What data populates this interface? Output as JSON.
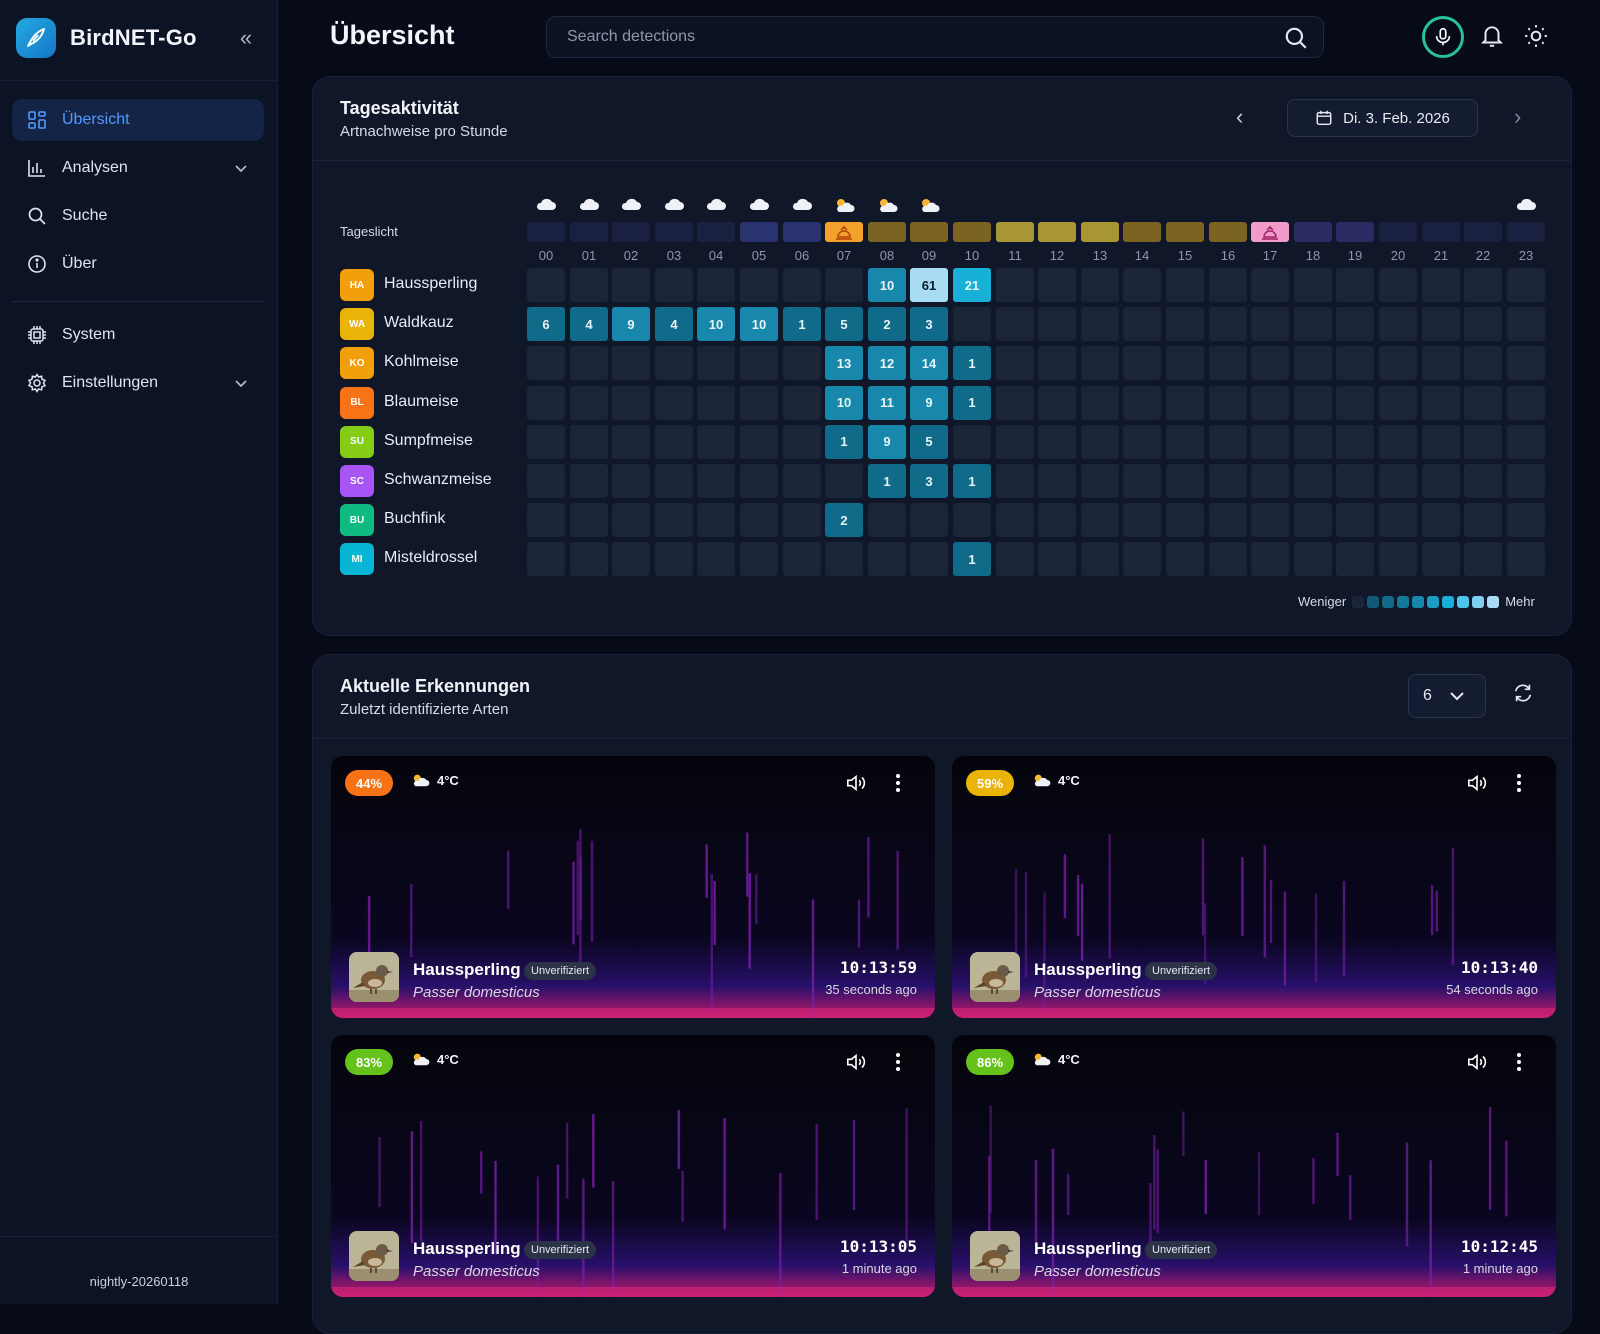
{
  "app": {
    "name": "BirdNET-Go",
    "version": "nightly-20260118"
  },
  "sidebar": {
    "items": [
      {
        "label": "Übersicht",
        "icon": "dashboard-grid-icon",
        "active": true
      },
      {
        "label": "Analysen",
        "icon": "bar-chart-icon",
        "expandable": true
      },
      {
        "label": "Suche",
        "icon": "search-icon"
      },
      {
        "label": "Über",
        "icon": "info-icon"
      },
      {
        "label": "System",
        "icon": "cpu-chip-icon"
      },
      {
        "label": "Einstellungen",
        "icon": "gear-icon",
        "expandable": true
      }
    ]
  },
  "header": {
    "title": "Übersicht",
    "search_placeholder": "Search detections"
  },
  "activity": {
    "title": "Tagesaktivität",
    "subtitle": "Artnachweise pro Stunde",
    "date": "Di. 3. Feb. 2026",
    "daylight_label": "Tageslicht",
    "hours": [
      "00",
      "01",
      "02",
      "03",
      "04",
      "05",
      "06",
      "07",
      "08",
      "09",
      "10",
      "11",
      "12",
      "13",
      "14",
      "15",
      "16",
      "17",
      "18",
      "19",
      "20",
      "21",
      "22",
      "23"
    ],
    "weather": [
      "cloud",
      "cloud",
      "cloud",
      "cloud",
      "cloud",
      "cloud",
      "cloud",
      "sun-cloud",
      "sun-cloud",
      "sun-cloud",
      "",
      "",
      "",
      "",
      "",
      "",
      "",
      "",
      "",
      "",
      "",
      "",
      "",
      "cloud"
    ],
    "daylight": [
      "night",
      "night",
      "night",
      "night",
      "night",
      "dawn",
      "dawn",
      "sunrise",
      "day",
      "day",
      "day",
      "bright",
      "bright",
      "bright",
      "day",
      "day",
      "day",
      "sunset",
      "dusk",
      "dusk",
      "night",
      "night",
      "night",
      "night"
    ],
    "legend_less": "Weniger",
    "legend_more": "Mehr",
    "colors": {
      "empty": "#1b2538",
      "low": "#106a8a",
      "mid": "#1787ac",
      "high": "#19b0d8",
      "top": "#a9dcf2",
      "accent": "#4f9bff"
    },
    "species": [
      {
        "code": "HA",
        "name": "Haussperling",
        "color": "#f59e0b",
        "counts": [
          null,
          null,
          null,
          null,
          null,
          null,
          null,
          null,
          10,
          61,
          21,
          null,
          null,
          null,
          null,
          null,
          null,
          null,
          null,
          null,
          null,
          null,
          null,
          null
        ]
      },
      {
        "code": "WA",
        "name": "Waldkauz",
        "color": "#eab308",
        "counts": [
          6,
          4,
          9,
          4,
          10,
          10,
          1,
          5,
          2,
          3,
          null,
          null,
          null,
          null,
          null,
          null,
          null,
          null,
          null,
          null,
          null,
          null,
          null,
          null
        ]
      },
      {
        "code": "KO",
        "name": "Kohlmeise",
        "color": "#f59e0b",
        "counts": [
          null,
          null,
          null,
          null,
          null,
          null,
          null,
          13,
          12,
          14,
          1,
          null,
          null,
          null,
          null,
          null,
          null,
          null,
          null,
          null,
          null,
          null,
          null,
          null
        ]
      },
      {
        "code": "BL",
        "name": "Blaumeise",
        "color": "#f97316",
        "counts": [
          null,
          null,
          null,
          null,
          null,
          null,
          null,
          10,
          11,
          9,
          1,
          null,
          null,
          null,
          null,
          null,
          null,
          null,
          null,
          null,
          null,
          null,
          null,
          null
        ]
      },
      {
        "code": "SU",
        "name": "Sumpfmeise",
        "color": "#84cc16",
        "counts": [
          null,
          null,
          null,
          null,
          null,
          null,
          null,
          1,
          9,
          5,
          null,
          null,
          null,
          null,
          null,
          null,
          null,
          null,
          null,
          null,
          null,
          null,
          null,
          null
        ]
      },
      {
        "code": "SC",
        "name": "Schwanzmeise",
        "color": "#a855f7",
        "counts": [
          null,
          null,
          null,
          null,
          null,
          null,
          null,
          null,
          1,
          3,
          1,
          null,
          null,
          null,
          null,
          null,
          null,
          null,
          null,
          null,
          null,
          null,
          null,
          null
        ]
      },
      {
        "code": "BU",
        "name": "Buchfink",
        "color": "#10b981",
        "counts": [
          null,
          null,
          null,
          null,
          null,
          null,
          null,
          2,
          null,
          null,
          null,
          null,
          null,
          null,
          null,
          null,
          null,
          null,
          null,
          null,
          null,
          null,
          null,
          null
        ]
      },
      {
        "code": "MI",
        "name": "Misteldrossel",
        "color": "#06b6d4",
        "counts": [
          null,
          null,
          null,
          null,
          null,
          null,
          null,
          null,
          null,
          null,
          1,
          null,
          null,
          null,
          null,
          null,
          null,
          null,
          null,
          null,
          null,
          null,
          null,
          null
        ]
      }
    ]
  },
  "detections": {
    "title": "Aktuelle Erkennungen",
    "subtitle": "Zuletzt identifizierte Arten",
    "limit": "6",
    "items": [
      {
        "confidence": "44%",
        "conf_color": "#f97316",
        "temp": "4°C",
        "name": "Haussperling",
        "badge": "Unverifiziert",
        "scientific": "Passer domesticus",
        "time": "10:13:59",
        "ago": "35 seconds ago"
      },
      {
        "confidence": "59%",
        "conf_color": "#eab308",
        "temp": "4°C",
        "name": "Haussperling",
        "badge": "Unverifiziert",
        "scientific": "Passer domesticus",
        "time": "10:13:40",
        "ago": "54 seconds ago"
      },
      {
        "confidence": "83%",
        "conf_color": "#65c21a",
        "temp": "4°C",
        "name": "Haussperling",
        "badge": "Unverifiziert",
        "scientific": "Passer domesticus",
        "time": "10:13:05",
        "ago": "1 minute ago"
      },
      {
        "confidence": "86%",
        "conf_color": "#65c21a",
        "temp": "4°C",
        "name": "Haussperling",
        "badge": "Unverifiziert",
        "scientific": "Passer domesticus",
        "time": "10:12:45",
        "ago": "1 minute ago"
      }
    ]
  }
}
